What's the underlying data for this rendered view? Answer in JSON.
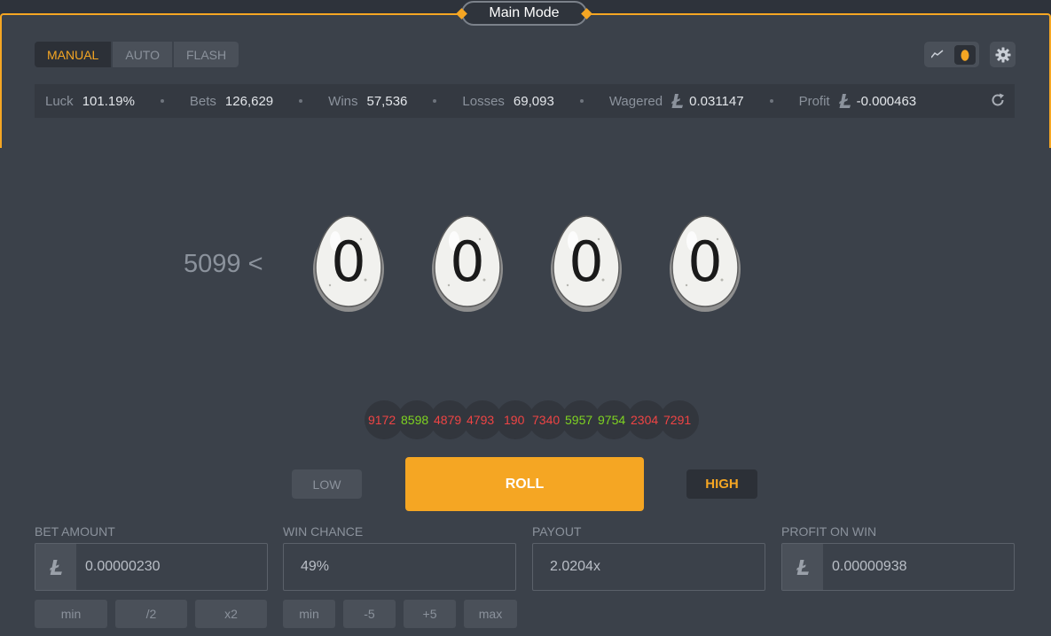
{
  "mode_title": "Main Mode",
  "tabs": [
    {
      "label": "MANUAL",
      "active": true
    },
    {
      "label": "AUTO",
      "active": false
    },
    {
      "label": "FLASH",
      "active": false
    }
  ],
  "stats": {
    "luck": {
      "label": "Luck",
      "value": "101.19%"
    },
    "bets": {
      "label": "Bets",
      "value": "126,629"
    },
    "wins": {
      "label": "Wins",
      "value": "57,536"
    },
    "losses": {
      "label": "Losses",
      "value": "69,093"
    },
    "wagered": {
      "label": "Wagered",
      "value": "0.031147"
    },
    "profit": {
      "label": "Profit",
      "value": "-0.000463"
    }
  },
  "game": {
    "threshold": "5099 <",
    "digits": [
      "0",
      "0",
      "0",
      "0"
    ]
  },
  "history": [
    {
      "value": "9172",
      "color": "red"
    },
    {
      "value": "8598",
      "color": "green"
    },
    {
      "value": "4879",
      "color": "red"
    },
    {
      "value": "4793",
      "color": "red"
    },
    {
      "value": "190",
      "color": "red"
    },
    {
      "value": "7340",
      "color": "red"
    },
    {
      "value": "5957",
      "color": "green"
    },
    {
      "value": "9754",
      "color": "green"
    },
    {
      "value": "2304",
      "color": "red"
    },
    {
      "value": "7291",
      "color": "red"
    }
  ],
  "buttons": {
    "low": "LOW",
    "roll": "ROLL",
    "high": "HIGH"
  },
  "fields": {
    "bet_amount": {
      "label": "BET AMOUNT",
      "value": "0.00000230"
    },
    "win_chance": {
      "label": "WIN CHANCE",
      "value": "49%"
    },
    "payout": {
      "label": "PAYOUT",
      "value": "2.0204x"
    },
    "profit_on_win": {
      "label": "PROFIT ON WIN",
      "value": "0.00000938"
    }
  },
  "bet_buttons": [
    "min",
    "/2",
    "x2"
  ],
  "chance_buttons": [
    "min",
    "-5",
    "+5",
    "max"
  ],
  "colors": {
    "accent": "#f5a623",
    "win": "#7ed321",
    "loss": "#ef4444"
  }
}
